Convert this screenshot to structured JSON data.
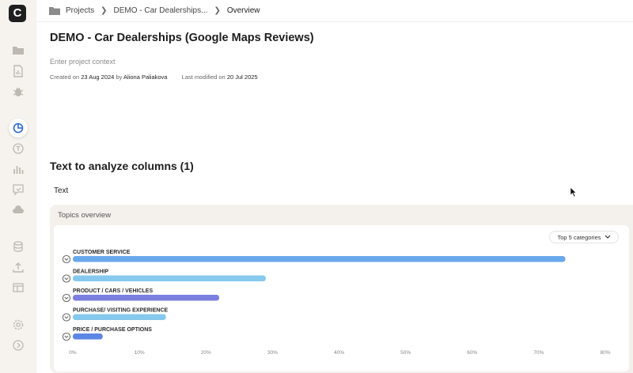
{
  "sidebar": {
    "logo_letter": "C",
    "icons": [
      "folder-icon",
      "document-chart-icon",
      "bug-icon",
      "pie-chart-icon",
      "text-circle-icon",
      "bar-chart-icon",
      "chat-icon",
      "cloud-icon",
      "database-icon",
      "upload-icon",
      "table-icon",
      "settings-icon",
      "expand-icon"
    ],
    "active": "pie-chart-icon"
  },
  "breadcrumb": {
    "items": [
      "Projects",
      "DEMO - Car Dealerships...",
      "Overview"
    ]
  },
  "project": {
    "title": "DEMO - Car Dealerships (Google Maps Reviews)",
    "context_placeholder": "Enter project context",
    "created_label": "Created on",
    "created_date": "23 Aug 2024",
    "by_label": "by",
    "author": "Aliona Paliakova",
    "modified_label": "Last modified on",
    "modified_date": "20 Jul 2025"
  },
  "columns_section": {
    "title": "Text to analyze columns (1)",
    "column_name": "Text"
  },
  "topics": {
    "title": "Topics overview",
    "dropdown_label": "Top 5 categories"
  },
  "chart_data": {
    "type": "bar",
    "orientation": "horizontal",
    "categories": [
      "CUSTOMER SERVICE",
      "DEALERSHIP",
      "PRODUCT / CARS / VEHICLES",
      "PURCHASE/ VISITING EXPERIENCE",
      "PRICE / PURCHASE OPTIONS"
    ],
    "values": [
      74,
      29,
      22,
      14,
      4.5
    ],
    "colors": [
      "#6aa8ec",
      "#86c9ee",
      "#7b7fe0",
      "#86c9ee",
      "#5b86e3"
    ],
    "xticks": [
      "0%",
      "10%",
      "20%",
      "30%",
      "40%",
      "50%",
      "60%",
      "70%",
      "80%"
    ],
    "xlim": [
      0,
      80
    ],
    "unit": "%"
  }
}
